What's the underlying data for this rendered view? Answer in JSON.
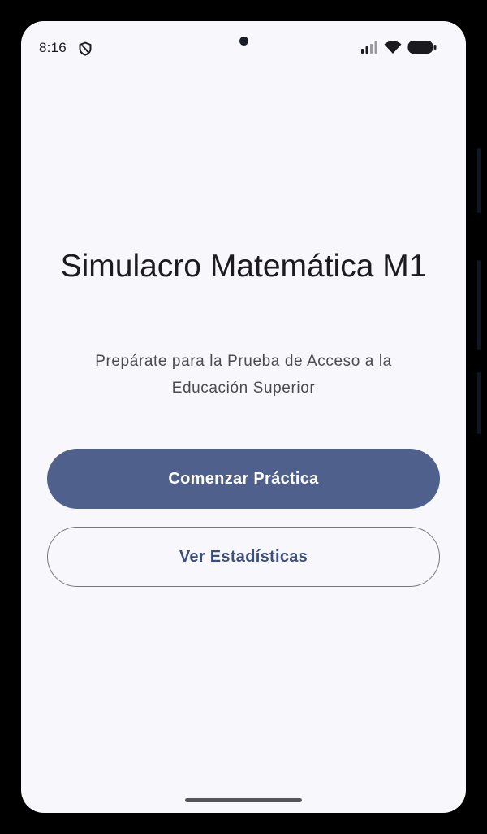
{
  "status_bar": {
    "time": "8:16",
    "icons": [
      "shield-icon",
      "signal-icon",
      "wifi-icon",
      "battery-icon"
    ]
  },
  "main": {
    "title": "Simulacro Matemática M1",
    "subtitle": "Prepárate para la Prueba de Acceso a la Educación Superior",
    "primary_button_label": "Comenzar Práctica",
    "secondary_button_label": "Ver Estadísticas"
  },
  "colors": {
    "background": "#f8f8fc",
    "primary": "#50608c",
    "outline_text": "#3d4f7c",
    "outline_border": "#76767e",
    "title_text": "#1d1b20",
    "subtitle_text": "#4a4a52"
  }
}
